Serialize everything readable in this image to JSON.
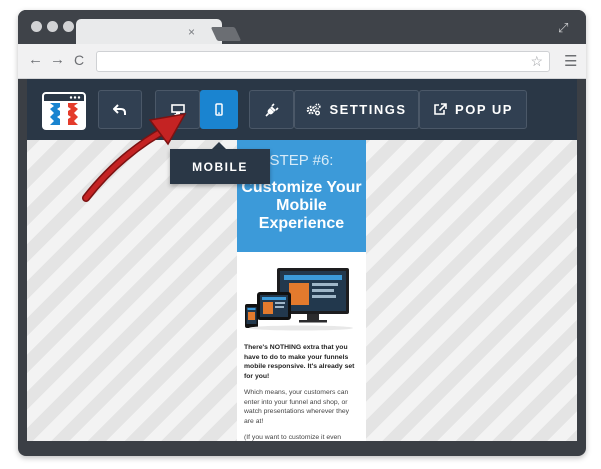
{
  "browser": {
    "tab": {
      "close_glyph": "×"
    },
    "nav": {
      "back_glyph": "←",
      "forward_glyph": "→",
      "reload_glyph": "C"
    },
    "address": {
      "value": "",
      "star_glyph": "☆"
    },
    "menu_glyph": "☰",
    "expand_glyph": "⤢"
  },
  "toolbar": {
    "undo_icon": "undo-icon",
    "desktop_icon": "desktop-icon",
    "mobile_icon": "mobile-icon",
    "plugin_icon": "plug-icon",
    "settings_label": "SETTINGS",
    "popup_label": "POP UP",
    "tooltip": "MOBILE"
  },
  "preview": {
    "step": "STEP #6:",
    "headline": "Customize Your Mobile Experience",
    "para1": "There's NOTHING extra that you have to do to make your funnels mobile responsive. It's already set for you!",
    "para2": "Which means, your customers can enter into your funnel and shop, or watch presentations wherever they are at!",
    "para3": "(If you want to customize it even further, you can turn on and off"
  },
  "colors": {
    "toolbar_bg": "#2a3746",
    "active_blue": "#1a84d0",
    "hero_blue": "#3c9ad9",
    "arrow_red": "#b51d1d"
  }
}
